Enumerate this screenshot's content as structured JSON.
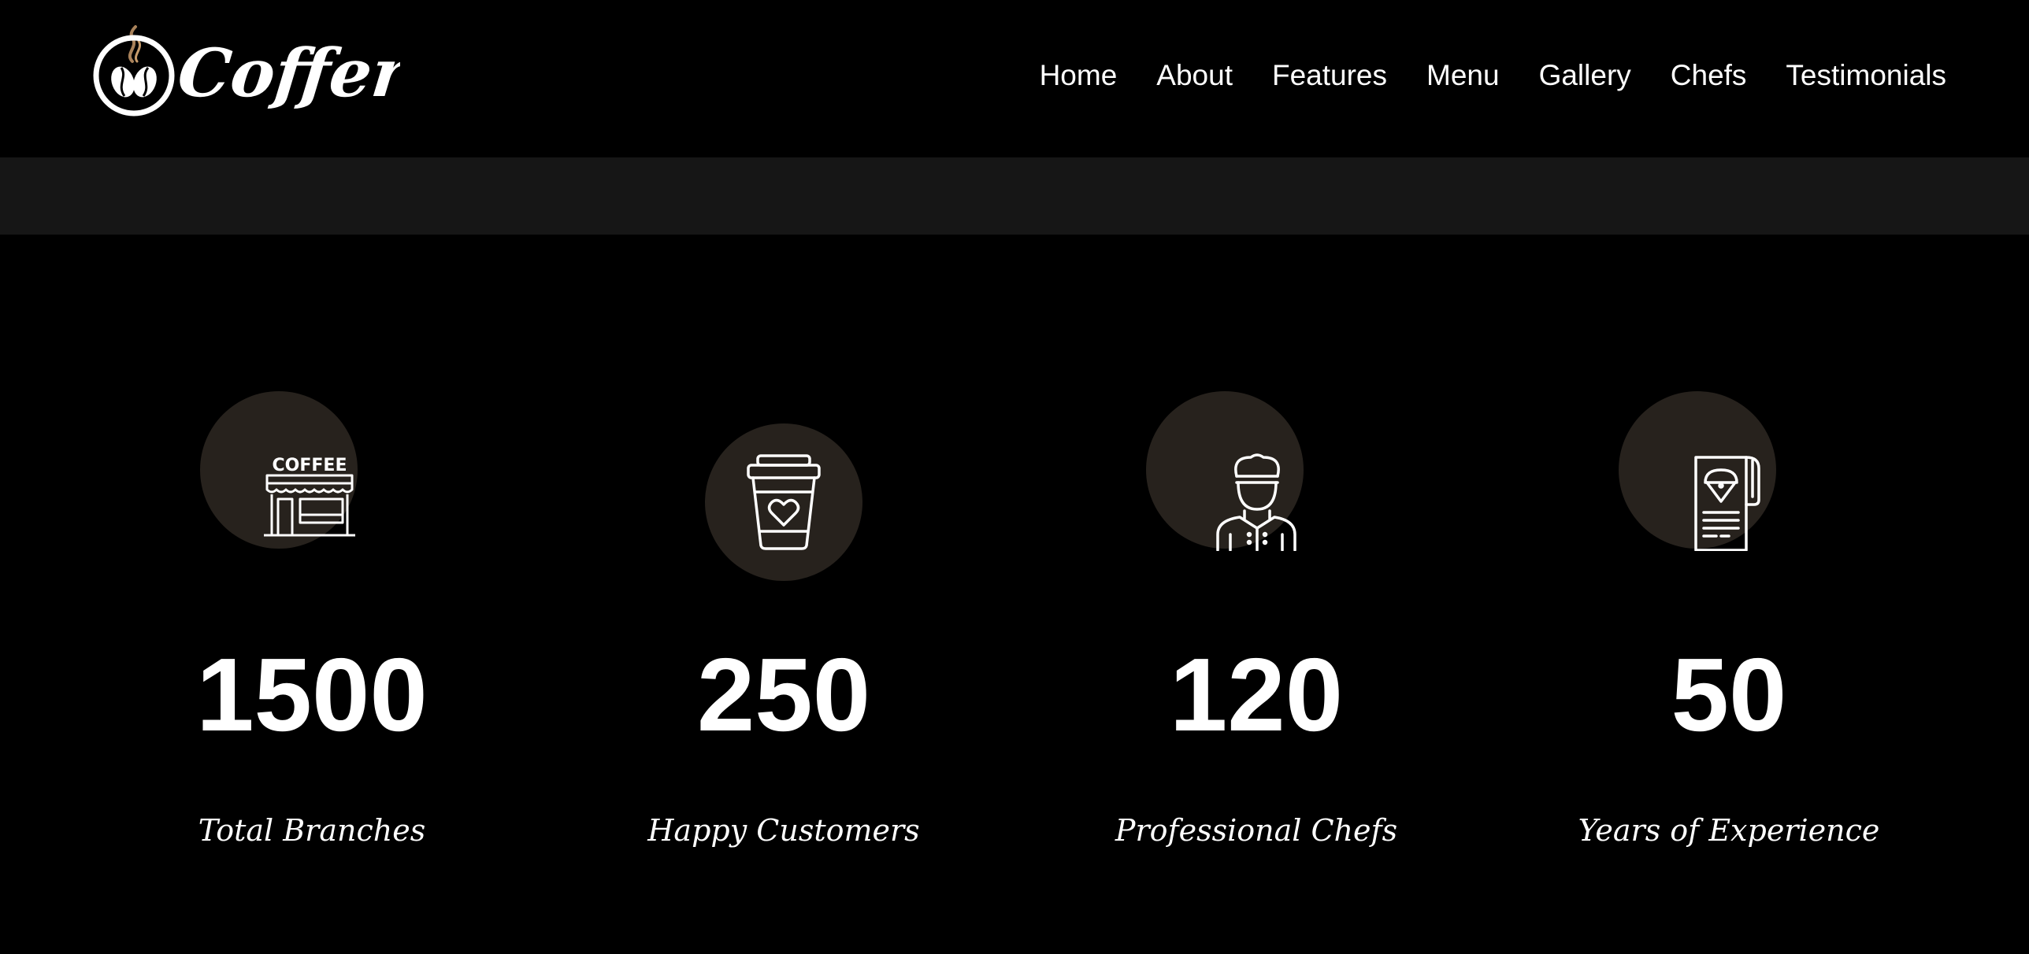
{
  "brand": {
    "name": "Coffero"
  },
  "nav": {
    "items": [
      "Home",
      "About",
      "Features",
      "Menu",
      "Gallery",
      "Chefs",
      "Testimonials"
    ]
  },
  "stats": [
    {
      "icon": "coffee-shop-icon",
      "sign_text": "COFFEE",
      "value": "1500",
      "label": "Total Branches"
    },
    {
      "icon": "coffee-cup-heart-icon",
      "value": "250",
      "label": "Happy Customers"
    },
    {
      "icon": "chef-icon",
      "value": "120",
      "label": "Professional Chefs"
    },
    {
      "icon": "menu-card-icon",
      "value": "50",
      "label": "Years of Experience"
    }
  ],
  "colors": {
    "background": "#000000",
    "band": "#161616",
    "icon_circle": "#27221d",
    "steam_accent": "#a9825a",
    "text": "#ffffff"
  }
}
